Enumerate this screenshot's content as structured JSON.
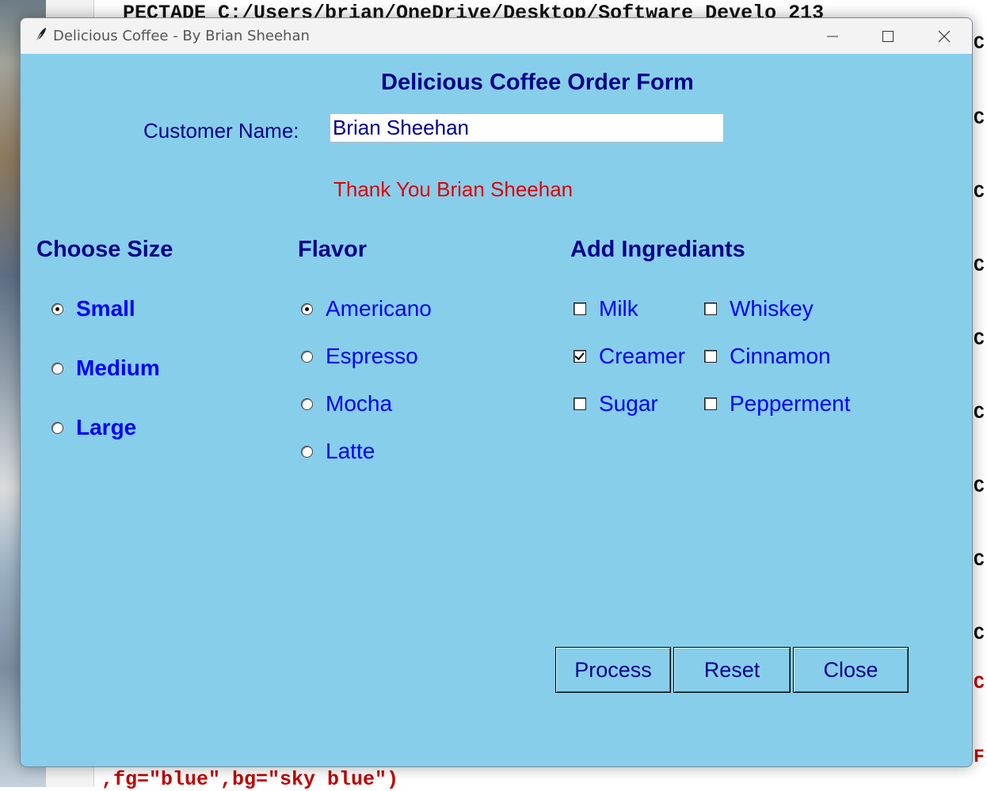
{
  "background": {
    "editor_top_text": "PECTADE C:/Users/brian/OneDrive/Desktop/Software Develo 213",
    "editor_bottom_text": ",fg=\"blue\",bg=\"sky blue\")",
    "right_fragments": [
      "C",
      "C",
      "C",
      "C",
      "C",
      "C",
      "C",
      "C",
      "C",
      "C"
    ],
    "right_red_fragments": [
      "C",
      "F"
    ]
  },
  "window": {
    "title": "Delicious Coffee - By Brian Sheehan",
    "controls": {
      "minimize": "minimize",
      "maximize": "maximize",
      "close": "close"
    }
  },
  "form": {
    "title": "Delicious Coffee Order Form",
    "name_label": "Customer Name:",
    "name_value": "Brian Sheehan",
    "thank_you": "Thank You Brian Sheehan"
  },
  "size": {
    "heading": "Choose Size",
    "options": [
      {
        "label": "Small",
        "selected": true
      },
      {
        "label": "Medium",
        "selected": false
      },
      {
        "label": "Large",
        "selected": false
      }
    ]
  },
  "flavor": {
    "heading": "Flavor",
    "options": [
      {
        "label": "Americano",
        "selected": true
      },
      {
        "label": "Espresso",
        "selected": false
      },
      {
        "label": "Mocha",
        "selected": false
      },
      {
        "label": "Latte",
        "selected": false
      }
    ]
  },
  "ingredients": {
    "heading": "Add Ingrediants",
    "options": [
      {
        "label": "Milk",
        "checked": false
      },
      {
        "label": "Creamer",
        "checked": true
      },
      {
        "label": "Sugar",
        "checked": false
      },
      {
        "label": "Whiskey",
        "checked": false
      },
      {
        "label": "Cinnamon",
        "checked": false
      },
      {
        "label": "Pepperment",
        "checked": false
      }
    ]
  },
  "buttons": {
    "process": "Process",
    "reset": "Reset",
    "close": "Close"
  },
  "colors": {
    "window_bg": "#87ceeb",
    "heading": "#00008b",
    "option_text": "#0000ff",
    "thank_you": "#e00000"
  }
}
